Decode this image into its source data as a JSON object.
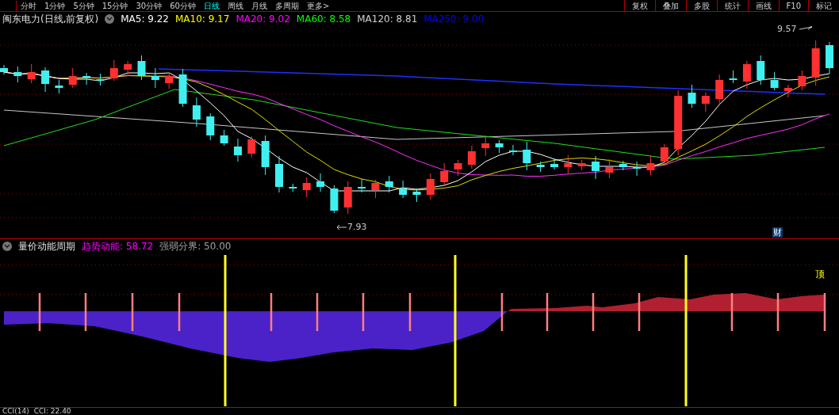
{
  "period_tabs": [
    {
      "label": "分时",
      "selected": false
    },
    {
      "label": "1分钟",
      "selected": false
    },
    {
      "label": "5分钟",
      "selected": false
    },
    {
      "label": "15分钟",
      "selected": false
    },
    {
      "label": "30分钟",
      "selected": false
    },
    {
      "label": "60分钟",
      "selected": false
    },
    {
      "label": "日线",
      "selected": true
    },
    {
      "label": "周线",
      "selected": false
    },
    {
      "label": "月线",
      "selected": false
    },
    {
      "label": "多周期",
      "selected": false
    },
    {
      "label": "更多>",
      "selected": false
    }
  ],
  "toolbar_buttons": [
    "复权",
    "叠加",
    "多股",
    "统计",
    "画线",
    "F10",
    "标记"
  ],
  "chart": {
    "title": "闽东电力(日线,前复权)",
    "legend": [
      {
        "label": "MA5: 9.22",
        "color": "#ffffff"
      },
      {
        "label": "MA10: 9.17",
        "color": "#ffff00"
      },
      {
        "label": "MA20: 9.02",
        "color": "#ff00ff"
      },
      {
        "label": "MA60: 8.58",
        "color": "#00ff00"
      },
      {
        "label": "MA120: 8.81",
        "color": "#d0d0d0"
      },
      {
        "label": "MA250: 9.00",
        "color": "#0000ff"
      }
    ],
    "high_label": "9.57",
    "low_label": "7.93",
    "badge": "财"
  },
  "indicator": {
    "title": "量价动能周期",
    "values": [
      {
        "label": "趋势动能: 58.72",
        "color": "#ff00ff"
      },
      {
        "label": "强弱分界: 50.00",
        "color": "#a0a0a0"
      }
    ],
    "marker": "顶"
  },
  "bottom_indicator": {
    "title": "CCI(14)",
    "value": "CCI: 22.40"
  }
}
